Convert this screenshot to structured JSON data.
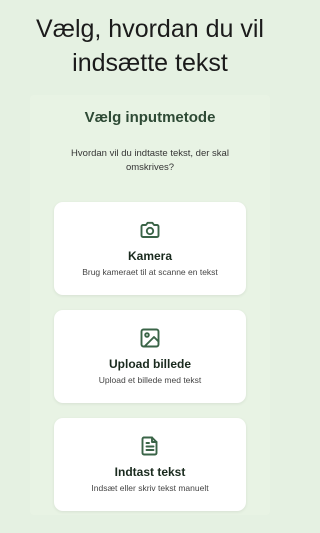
{
  "header": {
    "title": "Vælg, hvordan du vil indsætte tekst"
  },
  "panel": {
    "title": "Vælg inputmetode",
    "subtitle": "Hvordan vil du indtaste tekst, der skal omskrives?"
  },
  "options": [
    {
      "icon": "camera-icon",
      "title": "Kamera",
      "description": "Brug kameraet til at scanne en tekst"
    },
    {
      "icon": "image-icon",
      "title": "Upload billede",
      "description": "Upload et billede med tekst"
    },
    {
      "icon": "document-icon",
      "title": "Indtast tekst",
      "description": "Indsæt eller skriv tekst manuelt"
    }
  ],
  "colors": {
    "background": "#e5f1e2",
    "panel": "#e8f3e4",
    "accent": "#3a6447",
    "card": "#ffffff"
  }
}
